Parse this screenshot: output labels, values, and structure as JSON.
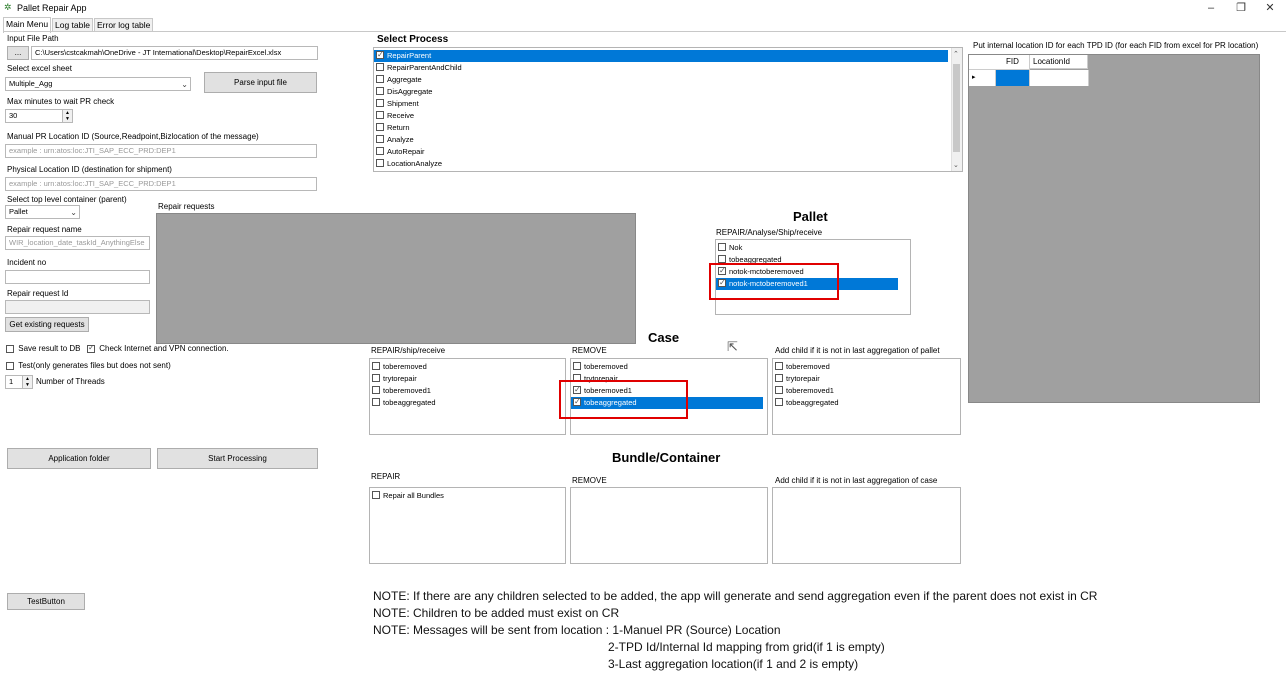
{
  "window": {
    "title": "Pallet Repair App",
    "minimize": "–",
    "restore": "❐",
    "close": "✕"
  },
  "tabs": [
    "Main Menu",
    "Log table",
    "Error log table"
  ],
  "input_file": {
    "label": "Input File Path",
    "browse": "...",
    "value": "C:\\Users\\cstcakmah\\OneDrive - JT International\\Desktop\\RepairExcel.xlsx"
  },
  "excel_sheet": {
    "label": "Select excel sheet",
    "value": "Multiple_Agg"
  },
  "parse_button": "Parse input file",
  "max_minutes": {
    "label": "Max minutes to wait PR check",
    "value": "30"
  },
  "manual_pr": {
    "label": "Manual PR Location ID (Source,Readpoint,Bizlocation of the message)",
    "placeholder": "example : urn:atos:loc:JTI_SAP_ECC_PRD:DEP1"
  },
  "physical_loc": {
    "label": "Physical Location ID (destination for shipment)",
    "placeholder": "example : urn:atos:loc:JTI_SAP_ECC_PRD:DEP1"
  },
  "top_container": {
    "label": "Select top level container (parent)",
    "value": "Pallet"
  },
  "repair_name": {
    "label": "Repair request name",
    "placeholder": "WIR_location_date_taskId_AnythingElse"
  },
  "incident": {
    "label": "Incident no",
    "value": ""
  },
  "repair_id": {
    "label": "Repair request Id",
    "value": ""
  },
  "get_existing": "Get existing requests",
  "repair_requests_label": "Repair requests",
  "save_db": "Save result to DB",
  "check_internet": "Check Internet and VPN connection.",
  "test_only": "Test(only generates files but does not sent)",
  "threads": {
    "value": "1",
    "label": "Number of Threads"
  },
  "app_folder": "Application folder",
  "start_processing": "Start Processing",
  "test_button": "TestButton",
  "select_process": {
    "title": "Select Process",
    "items": [
      "RepairParent",
      "RepairParentAndChild",
      "Aggregate",
      "DisAggregate",
      "Shipment",
      "Receive",
      "Return",
      "Analyze",
      "AutoRepair",
      "LocationAnalyze"
    ]
  },
  "pallet": {
    "title": "Pallet",
    "sub": "REPAIR/Analyse/Ship/receive",
    "items": [
      "Nok",
      "tobeaggregated",
      "notok-mctoberemoved",
      "notok-mctoberemoved1"
    ]
  },
  "case": {
    "title": "Case",
    "repair_label": "REPAIR/ship/receive",
    "repair_items": [
      "toberemoved",
      "trytorepair",
      "toberemoved1",
      "tobeaggregated"
    ],
    "remove_label": "REMOVE",
    "remove_items": [
      "toberemoved",
      "trytorepair",
      "toberemoved1",
      "tobeaggregated"
    ],
    "add_label": "Add child if it is not in last aggregation of pallet",
    "add_items": [
      "toberemoved",
      "trytorepair",
      "toberemoved1",
      "tobeaggregated"
    ]
  },
  "bundle": {
    "title": "Bundle/Container",
    "repair_label": "REPAIR",
    "repair_items": [
      "Repair all Bundles"
    ],
    "remove_label": "REMOVE",
    "add_label": "Add child if it is not in last aggregation of case"
  },
  "grid": {
    "label": "Put internal location ID for each TPD ID (for each FID from excel for PR location)",
    "columns": [
      "FID",
      "LocationId"
    ],
    "row_marker": "▸"
  },
  "notes": [
    "NOTE: If there are any children selected to be added, the app will generate and send aggregation even if the parent does not exist in CR",
    "NOTE: Children to be added must exist on CR",
    "NOTE: Messages will be sent from location : 1-Manuel PR (Source) Location",
    "2-TPD Id/Internal Id mapping from grid(if 1 is empty)",
    "3-Last aggregation location(if 1 and 2 is empty)"
  ],
  "colors": {
    "selection": "#0078d7",
    "highlight": "#e00000",
    "grey_area": "#a0a0a0"
  }
}
